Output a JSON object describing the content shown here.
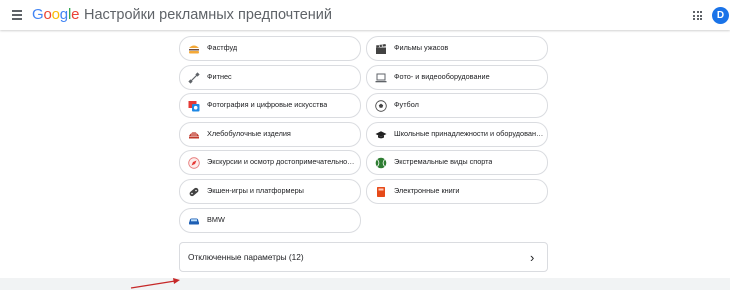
{
  "header": {
    "logo_letters": [
      {
        "ch": "G",
        "color": "#4285f4"
      },
      {
        "ch": "o",
        "color": "#ea4335"
      },
      {
        "ch": "o",
        "color": "#fbbc05"
      },
      {
        "ch": "g",
        "color": "#4285f4"
      },
      {
        "ch": "l",
        "color": "#34a853"
      },
      {
        "ch": "e",
        "color": "#ea4335"
      }
    ],
    "title": "Настройки рекламных предпочтений",
    "avatar_letter": "D",
    "avatar_color": "#1a73e8"
  },
  "left_items": [
    {
      "label": "Фастфуд",
      "icon": "burger-icon"
    },
    {
      "label": "Фитнес",
      "icon": "dumbbell-icon"
    },
    {
      "label": "Фотография и цифровые искусства",
      "icon": "photo-art-icon"
    },
    {
      "label": "Хлебобулочные изделия",
      "icon": "bread-icon"
    },
    {
      "label": "Экскурсии и осмотр достопримечательностей",
      "icon": "compass-icon"
    },
    {
      "label": "Экшен-игры и платформеры",
      "icon": "gamepad-icon"
    },
    {
      "label": "BMW",
      "icon": "car-icon"
    }
  ],
  "right_items": [
    {
      "label": "Фильмы ужасов",
      "icon": "clapperboard-icon"
    },
    {
      "label": "Фото- и видеооборудование",
      "icon": "laptop-icon"
    },
    {
      "label": "Футбол",
      "icon": "soccer-ball-icon"
    },
    {
      "label": "Школьные принадлежности и оборудование",
      "icon": "graduation-cap-icon"
    },
    {
      "label": "Экстремальные виды спорта",
      "icon": "tennis-ball-icon"
    },
    {
      "label": "Электронные книги",
      "icon": "ebook-icon"
    }
  ],
  "disabled_section": {
    "label": "Отключенные параметры (12)"
  },
  "accent_colors": {
    "annotation_arrow": "#c62828"
  }
}
